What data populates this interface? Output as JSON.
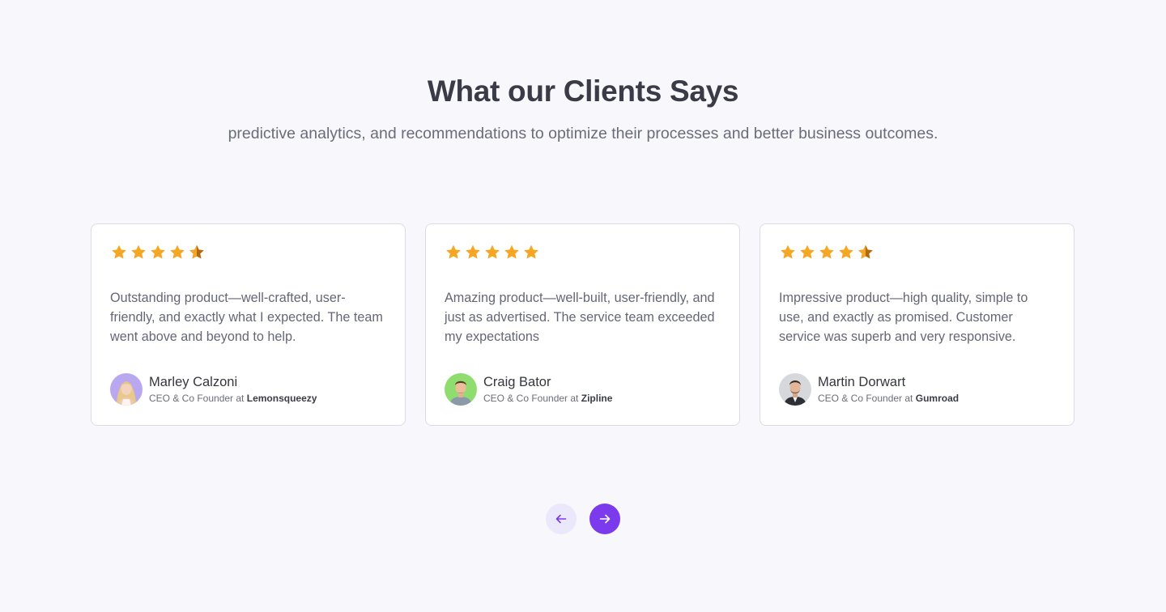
{
  "section": {
    "title": "What our Clients Says",
    "subtitle": "predictive analytics, and recommendations to optimize their processes and better business outcomes."
  },
  "colors": {
    "star": "#f5a623",
    "star_half": "#b4690e",
    "accent": "#7c3aed",
    "accent_light": "#ece8fb"
  },
  "testimonials": [
    {
      "rating": 4.5,
      "quote": "Outstanding product—well-crafted, user-friendly, and exactly what I expected. The team went above and beyond to help.",
      "name": "Marley Calzoni",
      "role_prefix": "CEO & Co Founder at",
      "company": "Lemonsqueezy",
      "avatar_icon": "avatar-blonde-woman"
    },
    {
      "rating": 5,
      "quote": "Amazing product—well-built, user-friendly, and just as advertised. The service team exceeded my expectations",
      "name": "Craig Bator",
      "role_prefix": "CEO & Co Founder at",
      "company": "Zipline",
      "avatar_icon": "avatar-man-green-background"
    },
    {
      "rating": 4.5,
      "quote": "Impressive product—high quality, simple to use, and exactly as promised. Customer service was superb and very responsive.",
      "name": "Martin Dorwart",
      "role_prefix": "CEO & Co Founder at",
      "company": "Gumroad",
      "avatar_icon": "avatar-man-grey-background"
    }
  ],
  "navigation": {
    "prev_icon": "arrow-left-icon",
    "next_icon": "arrow-right-icon"
  }
}
